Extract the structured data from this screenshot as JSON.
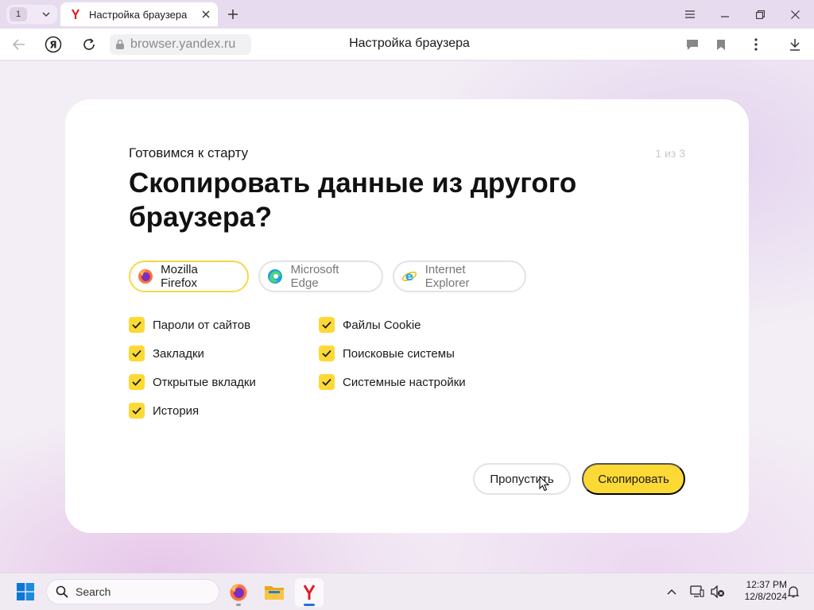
{
  "tabstrip": {
    "tab_count": "1",
    "active_tab_title": "Настройка браузера"
  },
  "toolbar": {
    "url": "browser.yandex.ru",
    "page_title": "Настройка браузера"
  },
  "dialog": {
    "subtitle": "Готовимся к старту",
    "step": "1 из 3",
    "title": "Скопировать данные из другого браузера?",
    "browsers": [
      {
        "name": "Mozilla Firefox",
        "selected": true
      },
      {
        "name": "Microsoft Edge",
        "selected": false
      },
      {
        "name": "Internet Explorer",
        "selected": false
      }
    ],
    "options_left": [
      {
        "label": "Пароли от сайтов",
        "checked": true
      },
      {
        "label": "Закладки",
        "checked": true
      },
      {
        "label": "Открытые вкладки",
        "checked": true
      },
      {
        "label": "История",
        "checked": true
      }
    ],
    "options_right": [
      {
        "label": "Файлы Cookie",
        "checked": true
      },
      {
        "label": "Поисковые системы",
        "checked": true
      },
      {
        "label": "Системные настройки",
        "checked": true
      }
    ],
    "skip_label": "Пропустить",
    "copy_label": "Скопировать"
  },
  "taskbar": {
    "search_placeholder": "Search",
    "time": "12:37 PM",
    "date": "12/8/2024"
  },
  "colors": {
    "accent": "#fdd935",
    "background": "#f3eef5",
    "tabstrip": "#e7dcef"
  }
}
